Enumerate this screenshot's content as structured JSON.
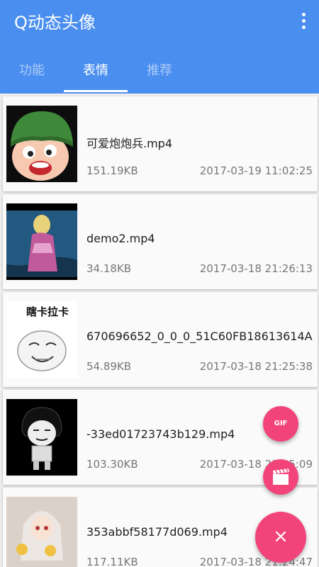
{
  "app": {
    "title": "Q动态头像"
  },
  "tabs": [
    {
      "label": "功能"
    },
    {
      "label": "表情"
    },
    {
      "label": "推荐"
    }
  ],
  "items": [
    {
      "name": "可爱炮炮兵.mp4",
      "size": "151.19KB",
      "date": "2017-03-19 11:02:25"
    },
    {
      "name": "demo2.mp4",
      "size": "34.18KB",
      "date": "2017-03-18 21:26:13"
    },
    {
      "name": "670696652_0_0_0_51C60FB18613614A",
      "size": "54.89KB",
      "date": "2017-03-18 21:25:38",
      "thumb_text": "瞎卡拉卡"
    },
    {
      "name": "-33ed01723743b129.mp4",
      "size": "103.30KB",
      "date": "2017-03-18 21:25:09"
    },
    {
      "name": "353abbf58177d069.mp4",
      "size": "117.11KB",
      "date": "2017-03-18 21:24:47"
    }
  ],
  "fab": {
    "gif_label": "GIF",
    "close_label": "×"
  },
  "colors": {
    "primary": "#4a8ef0",
    "accent": "#f2447a"
  },
  "icons": [
    "more-vert-icon",
    "movie-clapper-icon",
    "close-icon"
  ]
}
